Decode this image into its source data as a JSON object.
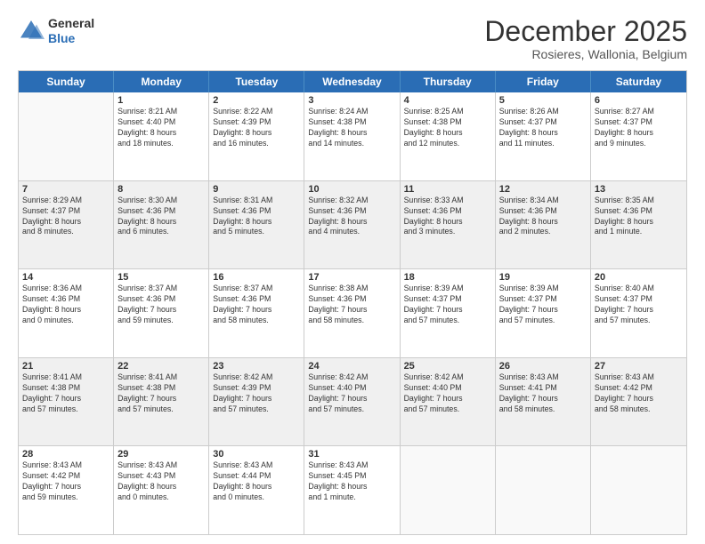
{
  "logo": {
    "general": "General",
    "blue": "Blue"
  },
  "title": "December 2025",
  "location": "Rosieres, Wallonia, Belgium",
  "weekdays": [
    "Sunday",
    "Monday",
    "Tuesday",
    "Wednesday",
    "Thursday",
    "Friday",
    "Saturday"
  ],
  "rows": [
    [
      {
        "day": "",
        "lines": []
      },
      {
        "day": "1",
        "lines": [
          "Sunrise: 8:21 AM",
          "Sunset: 4:40 PM",
          "Daylight: 8 hours",
          "and 18 minutes."
        ]
      },
      {
        "day": "2",
        "lines": [
          "Sunrise: 8:22 AM",
          "Sunset: 4:39 PM",
          "Daylight: 8 hours",
          "and 16 minutes."
        ]
      },
      {
        "day": "3",
        "lines": [
          "Sunrise: 8:24 AM",
          "Sunset: 4:38 PM",
          "Daylight: 8 hours",
          "and 14 minutes."
        ]
      },
      {
        "day": "4",
        "lines": [
          "Sunrise: 8:25 AM",
          "Sunset: 4:38 PM",
          "Daylight: 8 hours",
          "and 12 minutes."
        ]
      },
      {
        "day": "5",
        "lines": [
          "Sunrise: 8:26 AM",
          "Sunset: 4:37 PM",
          "Daylight: 8 hours",
          "and 11 minutes."
        ]
      },
      {
        "day": "6",
        "lines": [
          "Sunrise: 8:27 AM",
          "Sunset: 4:37 PM",
          "Daylight: 8 hours",
          "and 9 minutes."
        ]
      }
    ],
    [
      {
        "day": "7",
        "lines": [
          "Sunrise: 8:29 AM",
          "Sunset: 4:37 PM",
          "Daylight: 8 hours",
          "and 8 minutes."
        ]
      },
      {
        "day": "8",
        "lines": [
          "Sunrise: 8:30 AM",
          "Sunset: 4:36 PM",
          "Daylight: 8 hours",
          "and 6 minutes."
        ]
      },
      {
        "day": "9",
        "lines": [
          "Sunrise: 8:31 AM",
          "Sunset: 4:36 PM",
          "Daylight: 8 hours",
          "and 5 minutes."
        ]
      },
      {
        "day": "10",
        "lines": [
          "Sunrise: 8:32 AM",
          "Sunset: 4:36 PM",
          "Daylight: 8 hours",
          "and 4 minutes."
        ]
      },
      {
        "day": "11",
        "lines": [
          "Sunrise: 8:33 AM",
          "Sunset: 4:36 PM",
          "Daylight: 8 hours",
          "and 3 minutes."
        ]
      },
      {
        "day": "12",
        "lines": [
          "Sunrise: 8:34 AM",
          "Sunset: 4:36 PM",
          "Daylight: 8 hours",
          "and 2 minutes."
        ]
      },
      {
        "day": "13",
        "lines": [
          "Sunrise: 8:35 AM",
          "Sunset: 4:36 PM",
          "Daylight: 8 hours",
          "and 1 minute."
        ]
      }
    ],
    [
      {
        "day": "14",
        "lines": [
          "Sunrise: 8:36 AM",
          "Sunset: 4:36 PM",
          "Daylight: 8 hours",
          "and 0 minutes."
        ]
      },
      {
        "day": "15",
        "lines": [
          "Sunrise: 8:37 AM",
          "Sunset: 4:36 PM",
          "Daylight: 7 hours",
          "and 59 minutes."
        ]
      },
      {
        "day": "16",
        "lines": [
          "Sunrise: 8:37 AM",
          "Sunset: 4:36 PM",
          "Daylight: 7 hours",
          "and 58 minutes."
        ]
      },
      {
        "day": "17",
        "lines": [
          "Sunrise: 8:38 AM",
          "Sunset: 4:36 PM",
          "Daylight: 7 hours",
          "and 58 minutes."
        ]
      },
      {
        "day": "18",
        "lines": [
          "Sunrise: 8:39 AM",
          "Sunset: 4:37 PM",
          "Daylight: 7 hours",
          "and 57 minutes."
        ]
      },
      {
        "day": "19",
        "lines": [
          "Sunrise: 8:39 AM",
          "Sunset: 4:37 PM",
          "Daylight: 7 hours",
          "and 57 minutes."
        ]
      },
      {
        "day": "20",
        "lines": [
          "Sunrise: 8:40 AM",
          "Sunset: 4:37 PM",
          "Daylight: 7 hours",
          "and 57 minutes."
        ]
      }
    ],
    [
      {
        "day": "21",
        "lines": [
          "Sunrise: 8:41 AM",
          "Sunset: 4:38 PM",
          "Daylight: 7 hours",
          "and 57 minutes."
        ]
      },
      {
        "day": "22",
        "lines": [
          "Sunrise: 8:41 AM",
          "Sunset: 4:38 PM",
          "Daylight: 7 hours",
          "and 57 minutes."
        ]
      },
      {
        "day": "23",
        "lines": [
          "Sunrise: 8:42 AM",
          "Sunset: 4:39 PM",
          "Daylight: 7 hours",
          "and 57 minutes."
        ]
      },
      {
        "day": "24",
        "lines": [
          "Sunrise: 8:42 AM",
          "Sunset: 4:40 PM",
          "Daylight: 7 hours",
          "and 57 minutes."
        ]
      },
      {
        "day": "25",
        "lines": [
          "Sunrise: 8:42 AM",
          "Sunset: 4:40 PM",
          "Daylight: 7 hours",
          "and 57 minutes."
        ]
      },
      {
        "day": "26",
        "lines": [
          "Sunrise: 8:43 AM",
          "Sunset: 4:41 PM",
          "Daylight: 7 hours",
          "and 58 minutes."
        ]
      },
      {
        "day": "27",
        "lines": [
          "Sunrise: 8:43 AM",
          "Sunset: 4:42 PM",
          "Daylight: 7 hours",
          "and 58 minutes."
        ]
      }
    ],
    [
      {
        "day": "28",
        "lines": [
          "Sunrise: 8:43 AM",
          "Sunset: 4:42 PM",
          "Daylight: 7 hours",
          "and 59 minutes."
        ]
      },
      {
        "day": "29",
        "lines": [
          "Sunrise: 8:43 AM",
          "Sunset: 4:43 PM",
          "Daylight: 8 hours",
          "and 0 minutes."
        ]
      },
      {
        "day": "30",
        "lines": [
          "Sunrise: 8:43 AM",
          "Sunset: 4:44 PM",
          "Daylight: 8 hours",
          "and 0 minutes."
        ]
      },
      {
        "day": "31",
        "lines": [
          "Sunrise: 8:43 AM",
          "Sunset: 4:45 PM",
          "Daylight: 8 hours",
          "and 1 minute."
        ]
      },
      {
        "day": "",
        "lines": []
      },
      {
        "day": "",
        "lines": []
      },
      {
        "day": "",
        "lines": []
      }
    ]
  ]
}
